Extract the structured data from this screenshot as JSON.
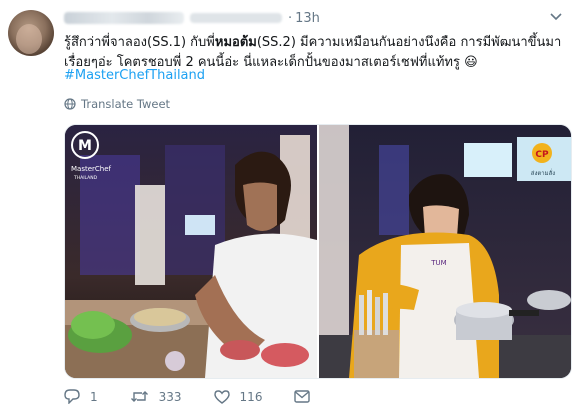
{
  "tweet": {
    "timestamp": "13h",
    "text_part1": "รู้สึกว่าพี่จาลอง(SS.1) กับพี่",
    "text_bold": "หมอต้ม",
    "text_part2": "(SS.2) มีความเหมือนกันอย่างนึงคือ การมีพัฒนาขึ้นมาเรื่อยๆอ่ะ โคตรชอบพี่ 2 คนนี้อ่ะ นี่แหละเด็กปั้นของมาสเตอร์เชฟที่แท้ทรู",
    "emoji": "😃",
    "hashtag": "#MasterChefThailand",
    "translate_label": "Translate Tweet"
  },
  "media": {
    "left_logo_text": "MasterChef",
    "left_logo_sub": "THAILAND",
    "right_badge": "CP",
    "right_screen_text": "ส่งตามสั่ง",
    "apron_name": "TUM"
  },
  "actions": {
    "reply_count": "1",
    "retweet_count": "333",
    "like_count": "116"
  },
  "colors": {
    "link": "#1da1f2",
    "secondary": "#657786",
    "text": "#14171a"
  }
}
